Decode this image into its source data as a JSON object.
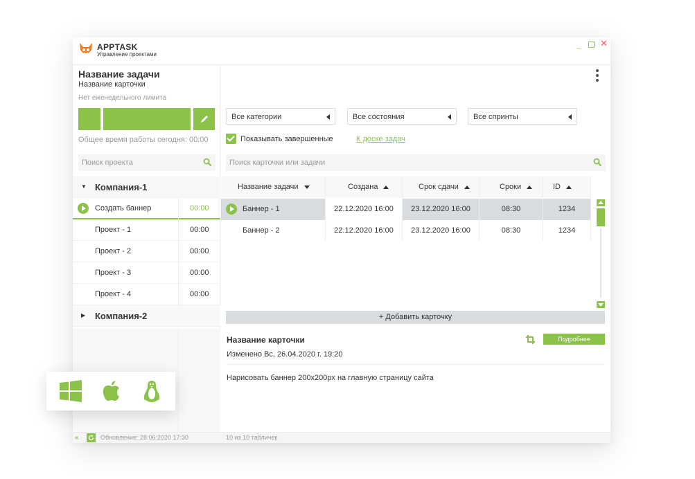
{
  "app": {
    "name": "APPTASK",
    "subtitle": "Управление проектами"
  },
  "left": {
    "task_title": "Название задачи",
    "card_title": "Название карточки",
    "limit_note": "Нет еженедельного лимита",
    "worktime": "Общее время работы сегодня: 00:00",
    "search_placeholder": "Поиск проекта"
  },
  "tree": {
    "company1": "Компания-1",
    "items": [
      {
        "label": "Создать баннер",
        "time": "00:00"
      },
      {
        "label": "Проект - 1",
        "time": "00:00"
      },
      {
        "label": "Проект - 2",
        "time": "00:00"
      },
      {
        "label": "Проект - 3",
        "time": "00:00"
      },
      {
        "label": "Проект - 4",
        "time": "00:00"
      }
    ],
    "company2": "Компания-2"
  },
  "filters": {
    "categories": "Все категории",
    "states": "Все состояния",
    "sprints": "Все спринты",
    "show_completed": "Показывать завершенные",
    "board_link": "К доске задач",
    "search_placeholder": "Поиск карточки или задачи"
  },
  "table": {
    "headers": [
      "Название задачи",
      "Создана",
      "Срок сдачи",
      "Сроки",
      "ID"
    ],
    "rows": [
      [
        "Баннер - 1",
        "22.12.2020 16:00",
        "23.12.2020 16:00",
        "08:30",
        "1234"
      ],
      [
        "Баннер - 2",
        "22.12.2020 16:00",
        "23.12.2020 16:00",
        "08:30",
        "1234"
      ]
    ],
    "add_card": "+ Добавить карточку"
  },
  "detail": {
    "title": "Название карточки",
    "more_button": "Подробнее",
    "modified": "Изменено Вс, 26.04.2020 г. 19:20",
    "body": "Нарисовать баннер 200x200px на главную страницу сайта"
  },
  "status": {
    "update": "Обновление: 28:06:2020 17:30",
    "count": "10 из 10 табличек"
  },
  "colors": {
    "accent": "#8bc34a",
    "selected_row": "#d9dcdf",
    "close": "#ff5a5a"
  },
  "icons": [
    "windows-icon",
    "apple-icon",
    "linux-icon",
    "pencil-icon",
    "search-icon",
    "crop-icon",
    "refresh-icon"
  ]
}
